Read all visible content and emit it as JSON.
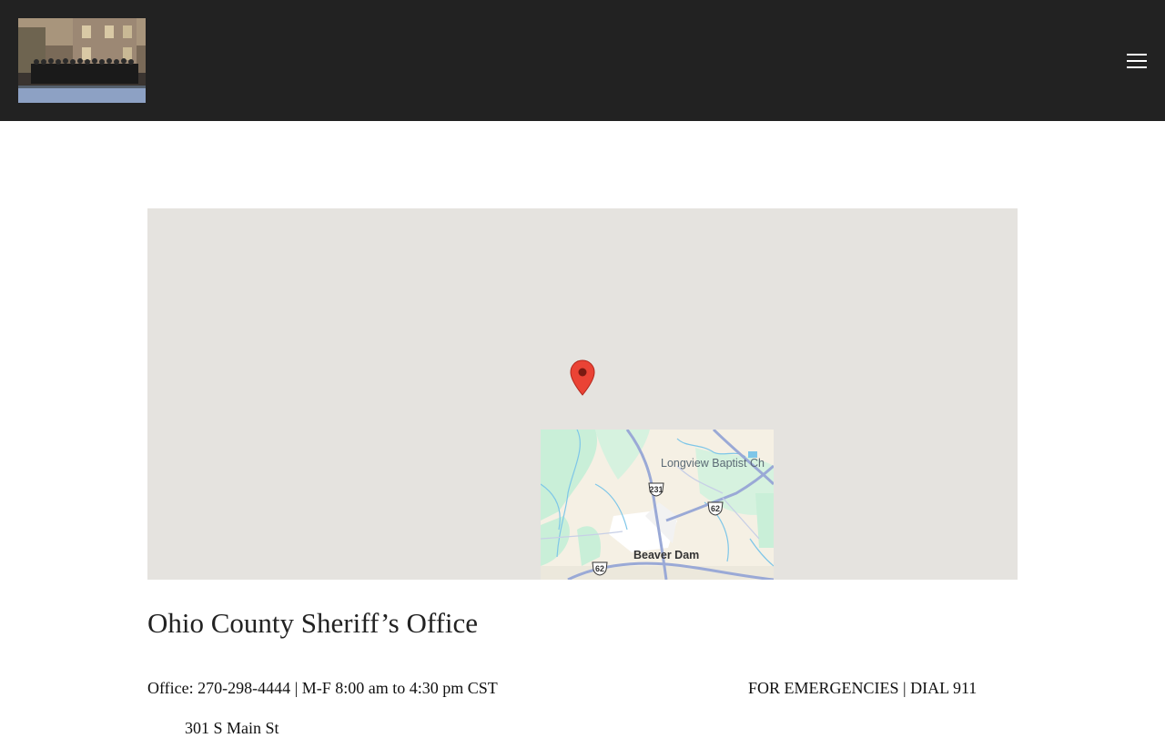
{
  "header": {
    "logo_alt": "Ohio County Sheriff's Office staff photo",
    "menu_icon": "hamburger-menu-icon"
  },
  "map": {
    "marker_icon": "map-pin-icon",
    "labels": {
      "church": "Longview Baptist Ch",
      "town": "Beaver Dam"
    },
    "route_shields": [
      "231",
      "62",
      "62"
    ]
  },
  "content": {
    "title": "Ohio County Sheriff’s Office",
    "office_line": "Office: 270-298-4444 | M-F 8:00 am to 4:30 pm CST",
    "emergency_line": "FOR EMERGENCIES  | DIAL 911",
    "address_line": "301 S Main St"
  },
  "colors": {
    "header_bg": "#222222",
    "map_bg": "#e5e3df",
    "marker": "#ea4335"
  }
}
